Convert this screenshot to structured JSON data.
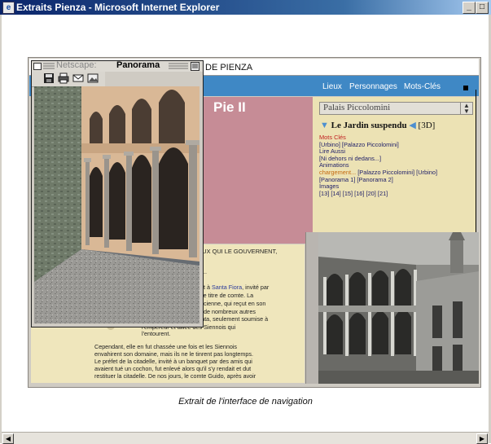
{
  "window": {
    "title": "Extraits Pienza - Microsoft Internet Explorer",
    "minimize_glyph": "_",
    "maximize_glyph": "□"
  },
  "site": {
    "header_title": "DE PIENZA",
    "nav": [
      "Lieux",
      "Personnages",
      "Mots-Clés"
    ],
    "hero_title": "Pie II",
    "select_value": "Palais Piccolomini",
    "jardin": {
      "title": "Le Jardin suspendu",
      "link_3d": "[3D]"
    },
    "right_lines": [
      {
        "text": "Mots Clés",
        "color": "red"
      },
      {
        "text": "[Urbino] [Palazzo Piccolomini]"
      },
      {
        "text": "Lire Aussi"
      },
      {
        "text": "[Ni dehors ni dedans...]"
      },
      {
        "text": "Animations"
      },
      {
        "text": "chargement... [Palazzo Piccolomini] [Urbino]",
        "prefix": "chargement...",
        "prefix_color": "orange"
      },
      {
        "text": "[Panorama 1] [Panorama 2]"
      },
      {
        "text": "Images"
      },
      {
        "text": "[13] [14] [15] [16] [20] [21]"
      }
    ],
    "left_heading": "CEUX QUI LE GOUVERNENT,",
    "left_dots": "...",
    "left_lines": [
      {
        "text": "ent à",
        "link": "Santa Fiora",
        "after": ", invité par"
      },
      {
        "text": "a le titre de comte. La"
      },
      {
        "text": "ancienne, qui reçut en son"
      },
      {
        "text": "et de nombreux autres"
      },
      {
        "text": "siata, seulement soumise à"
      },
      {
        "text": "l'empereur et alliée des Siennois qui"
      },
      {
        "text": "l'entourent."
      }
    ],
    "paragraph2": [
      "Cependant, elle en fut chassée une fois et les Siennois",
      "envahirent son domaine, mais ils ne le tinrent pas longtemps.",
      "Le préfet de la citadelle, invité à un banquet par des amis qui",
      "avaient tué un cochon, fut enlevé alors qu'il s'y rendait et dut",
      "restituer la citadelle. De nos jours, le comte Guido, après avoir"
    ]
  },
  "panorama": {
    "title": "Panorama",
    "ghost_title": "Netscape:",
    "toolbar_icons": [
      "save-icon",
      "print-icon",
      "mail-icon",
      "image-icon"
    ]
  },
  "caption": "Extrait de l'interface de navigation",
  "scroll": {
    "left": "◀",
    "right": "▶"
  }
}
